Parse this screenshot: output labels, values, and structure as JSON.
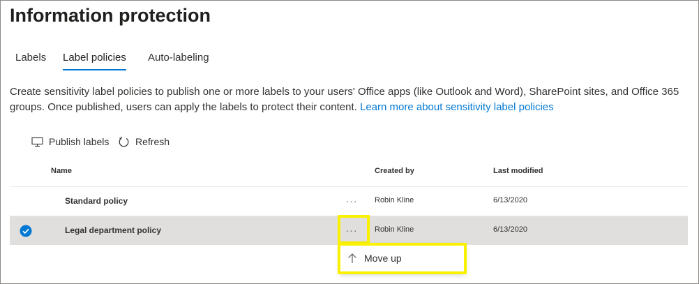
{
  "page": {
    "title": "Information protection"
  },
  "tabs": [
    {
      "label": "Labels"
    },
    {
      "label": "Label policies",
      "active": true
    },
    {
      "label": "Auto-labeling"
    }
  ],
  "description": {
    "text": "Create sensitivity label policies to publish one or more labels to your users' Office apps (like Outlook and Word), SharePoint sites, and Office 365 groups. Once published, users can apply the labels to protect their content.",
    "link": "Learn more about sensitivity label policies"
  },
  "commands": {
    "publish_label": "Publish labels",
    "publish_icon": "monitor-icon",
    "refresh_label": "Refresh",
    "refresh_icon": "refresh-icon"
  },
  "table": {
    "columns": {
      "name": "Name",
      "created_by": "Created by",
      "last_modified": "Last modified"
    },
    "more_glyph": "···",
    "rows": [
      {
        "name": "Standard policy",
        "created_by": "Robin Kline",
        "last_modified": "6/13/2020",
        "selected": false
      },
      {
        "name": "Legal department policy",
        "created_by": "Robin Kline",
        "last_modified": "6/13/2020",
        "selected": true
      }
    ]
  },
  "context_menu": {
    "items": [
      {
        "label": "Move up",
        "icon": "arrow-up-icon"
      }
    ]
  },
  "colors": {
    "accent": "#0078d4",
    "highlight": "#f9f100",
    "selected_row": "#e1dfdd"
  }
}
